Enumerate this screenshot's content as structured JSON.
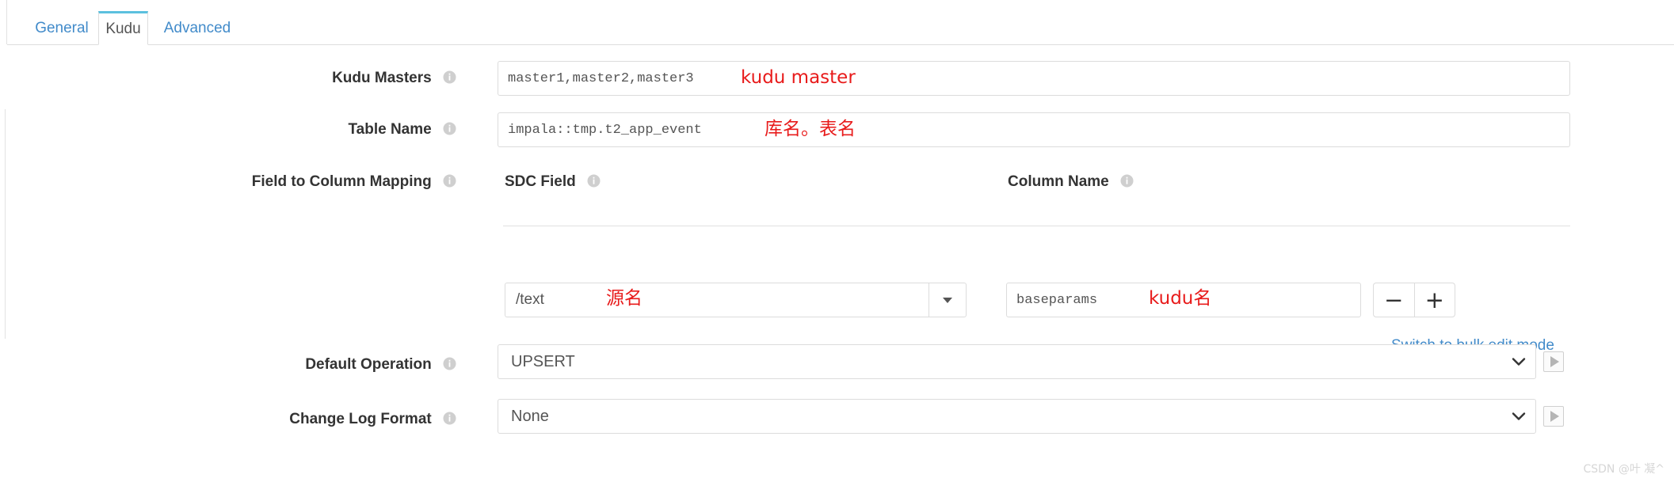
{
  "tabs": [
    {
      "label": "General",
      "active": false
    },
    {
      "label": "Kudu",
      "active": true
    },
    {
      "label": "Advanced",
      "active": false
    }
  ],
  "fields": {
    "kudu_masters": {
      "label": "Kudu Masters",
      "value": "master1,master2,master3",
      "annotation": "kudu master"
    },
    "table_name": {
      "label": "Table Name",
      "value": "impala::tmp.t2_app_event",
      "annotation": "库名。表名"
    },
    "field_to_column_mapping": {
      "label": "Field to Column Mapping",
      "columns": {
        "sdc_field": "SDC Field",
        "column_name": "Column Name"
      },
      "rows": [
        {
          "sdc_field": "/text",
          "sdc_annotation": "源名",
          "column_name": "baseparams",
          "column_annotation": "kudu名",
          "remove_label": "−",
          "add_label": "+"
        }
      ],
      "bulk_edit_link": "Switch to bulk edit mode"
    },
    "default_operation": {
      "label": "Default Operation",
      "value": "UPSERT"
    },
    "change_log_format": {
      "label": "Change Log Format",
      "value": "None"
    }
  },
  "watermark": "CSDN @叶 凝^",
  "colors": {
    "accent_tab": "#5bc0de",
    "link": "#428bca",
    "annotation": "#e81b1b",
    "border": "#dcdcdc"
  }
}
